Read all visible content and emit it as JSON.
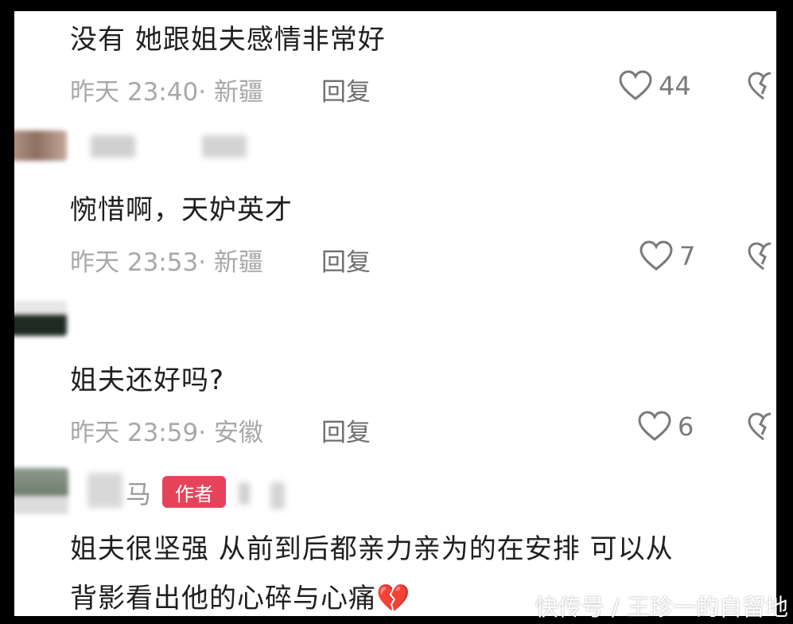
{
  "comments": [
    {
      "text": "没有 她跟姐夫感情非常好",
      "meta": "昨天 23:40· 新疆",
      "reply": "回复",
      "likes": "44"
    },
    {
      "text": "惋惜啊，天妒英才",
      "meta": "昨天 23:53· 新疆",
      "reply": "回复",
      "likes": "7"
    },
    {
      "text": "姐夫还好吗?",
      "meta": "昨天 23:59· 安徽",
      "reply": "回复",
      "likes": "6"
    },
    {
      "username": "马",
      "badge": "作者",
      "text_line1": "姐夫很坚强 从前到后都亲力亲为的在安排 可以从",
      "text_line2": "背影看出他的心碎与心痛",
      "emoji": "💔"
    }
  ],
  "watermark": "快传号 / 王珍一的自留地",
  "colors": {
    "badge": "#e5435a",
    "meta": "#a8a8a8",
    "text": "#1f1f1f"
  }
}
